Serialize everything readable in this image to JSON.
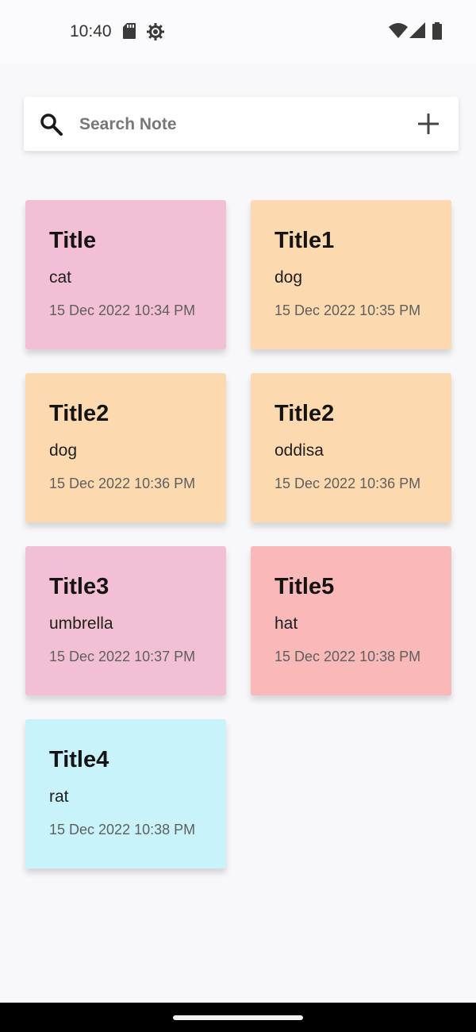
{
  "status_bar": {
    "time": "10:40",
    "left_icons": [
      "sd-card-icon",
      "gear-icon"
    ],
    "right_icons": [
      "wifi-icon",
      "signal-icon",
      "battery-icon"
    ]
  },
  "search": {
    "placeholder": "Search Note",
    "value": "",
    "search_icon": "search-icon",
    "add_icon": "plus-icon"
  },
  "notes": [
    {
      "title": "Title",
      "body": "cat",
      "date": "15 Dec 2022 10:34 PM",
      "color": "#f2bfd5"
    },
    {
      "title": "Title1",
      "body": "dog",
      "date": "15 Dec 2022 10:35 PM",
      "color": "#fdd9af"
    },
    {
      "title": "Title2",
      "body": "dog",
      "date": "15 Dec 2022 10:36 PM",
      "color": "#fdd9af"
    },
    {
      "title": "Title2",
      "body": "oddisa",
      "date": "15 Dec 2022 10:36 PM",
      "color": "#fdd9af"
    },
    {
      "title": "Title3",
      "body": "umbrella",
      "date": "15 Dec 2022 10:37 PM",
      "color": "#f2bfd5"
    },
    {
      "title": "Title5",
      "body": "hat",
      "date": "15 Dec 2022 10:38 PM",
      "color": "#f8b9b8"
    },
    {
      "title": "Title4",
      "body": "rat",
      "date": "15 Dec 2022 10:38 PM",
      "color": "#c8f3fb"
    }
  ],
  "nav_bar": {
    "handle": "home-gesture-handle"
  }
}
